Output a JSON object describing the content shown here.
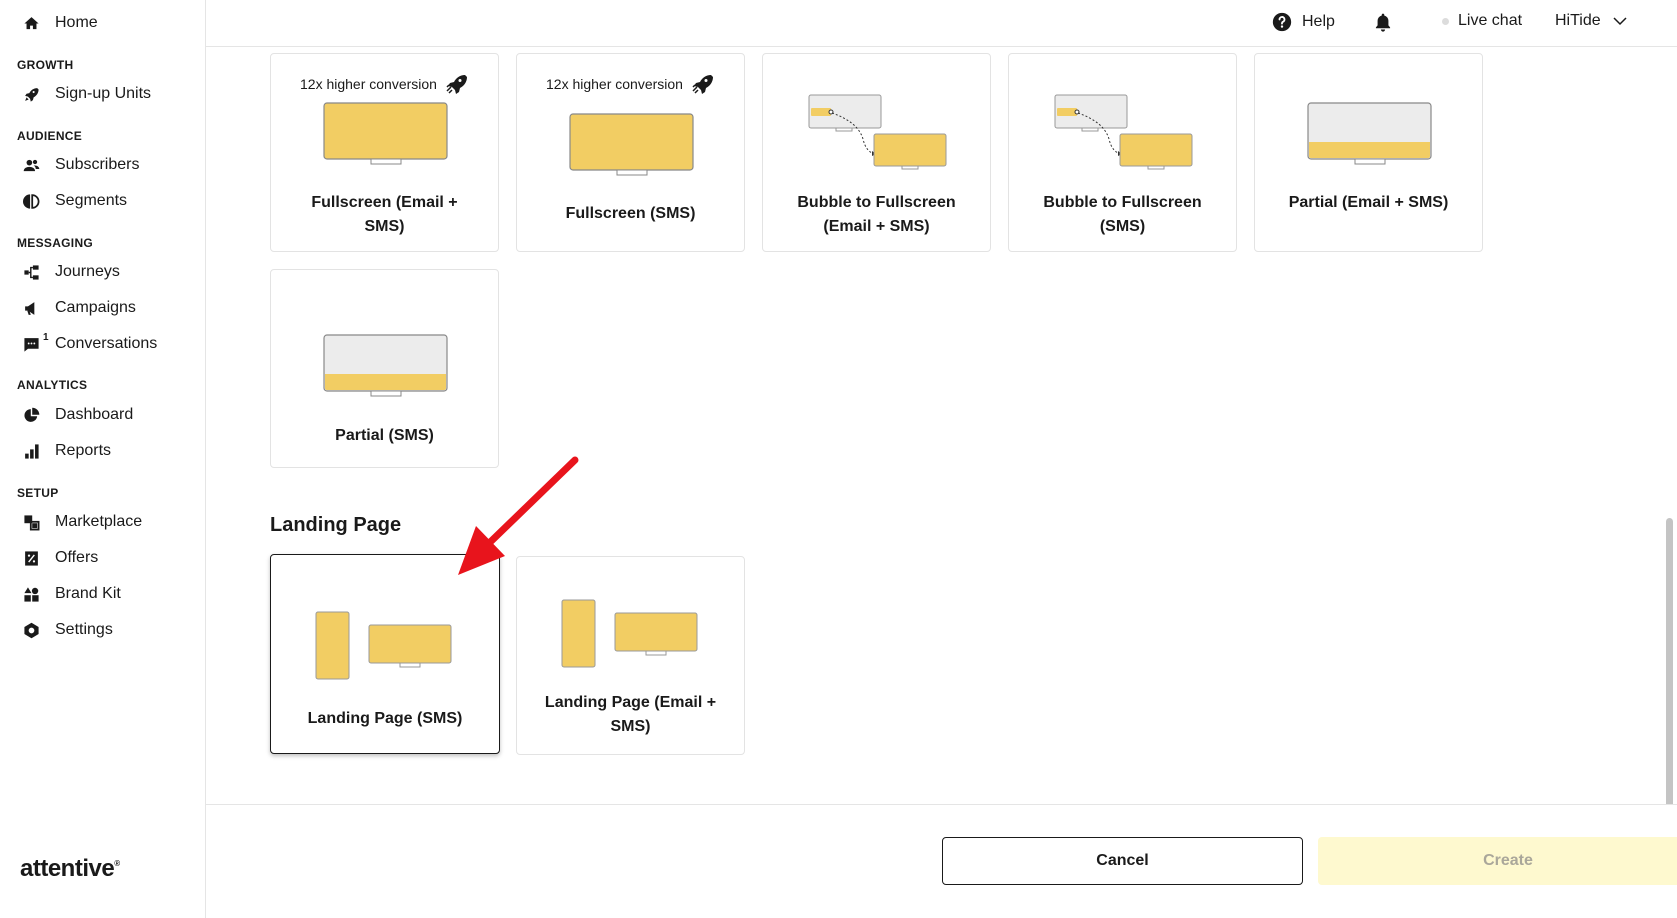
{
  "sidebar": {
    "home": "Home",
    "sections": {
      "growth": "GROWTH",
      "audience": "AUDIENCE",
      "messaging": "MESSAGING",
      "analytics": "ANALYTICS",
      "setup": "SETUP"
    },
    "items": {
      "signup_units": "Sign-up Units",
      "subscribers": "Subscribers",
      "segments": "Segments",
      "journeys": "Journeys",
      "campaigns": "Campaigns",
      "conversations": "Conversations",
      "conversations_badge": "1",
      "dashboard": "Dashboard",
      "reports": "Reports",
      "marketplace": "Marketplace",
      "offers": "Offers",
      "brand_kit": "Brand Kit",
      "settings": "Settings"
    },
    "logo": "attentive",
    "logo_mark": "®"
  },
  "header": {
    "help": "Help",
    "live_chat": "Live chat",
    "account": "HiTide"
  },
  "cards": {
    "conversion_note": "12x higher conversion",
    "fullscreen_email_sms": "Fullscreen (Email + SMS)",
    "fullscreen_sms": "Fullscreen (SMS)",
    "bubble_email_sms": "Bubble to Fullscreen (Email + SMS)",
    "bubble_sms": "Bubble to Fullscreen (SMS)",
    "partial_email_sms": "Partial (Email + SMS)",
    "partial_sms": "Partial (SMS)",
    "landing_sms": "Landing Page (SMS)",
    "landing_email_sms": "Landing Page (Email + SMS)"
  },
  "sections": {
    "landing_page": "Landing Page"
  },
  "footer": {
    "cancel": "Cancel",
    "create": "Create"
  },
  "colors": {
    "accent_yellow": "#f2cd63",
    "screen_gray": "#ececec",
    "create_disabled_bg": "#fef9cf",
    "annotation_red": "#e8141c"
  }
}
